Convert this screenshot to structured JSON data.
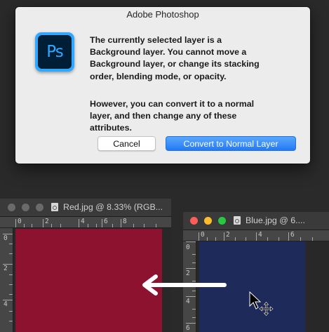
{
  "dialog": {
    "title": "Adobe Photoshop",
    "app_icon": "photoshop-logo",
    "logo_text": "Ps",
    "message_line1": "The currently selected layer is a",
    "message_line2": "Background layer. You cannot move a",
    "message_line3": "Background layer, or change its stacking",
    "message_line4": "order, blending mode, or opacity.",
    "message2_line1": "However, you can convert it to a normal",
    "message2_line2": "layer, and then change any of these",
    "message2_line3": "attributes.",
    "cancel_label": "Cancel",
    "convert_label": "Convert to Normal Layer",
    "colors": {
      "default_button": "#2479f5",
      "logo_bg": "#001e36",
      "logo_accent": "#31a8ff"
    }
  },
  "documents": [
    {
      "title": "Red.jpg @ 8.33% (RGB...",
      "canvas_color": "#8c1230",
      "ruler_h_labels": [
        "0",
        "2",
        "4",
        "6",
        "8"
      ],
      "ruler_v_labels": [
        "0",
        "2",
        "4"
      ]
    },
    {
      "title": "Blue.jpg @ 6....",
      "canvas_color": "#1e2a5a",
      "ruler_h_labels": [
        "0",
        "2",
        "4",
        "6"
      ],
      "ruler_v_labels": [
        "0",
        "2",
        "4",
        "6"
      ]
    }
  ],
  "overlay": {
    "arrow_icon": "left-arrow-icon",
    "cursor_icon": "move-cursor-icon"
  }
}
